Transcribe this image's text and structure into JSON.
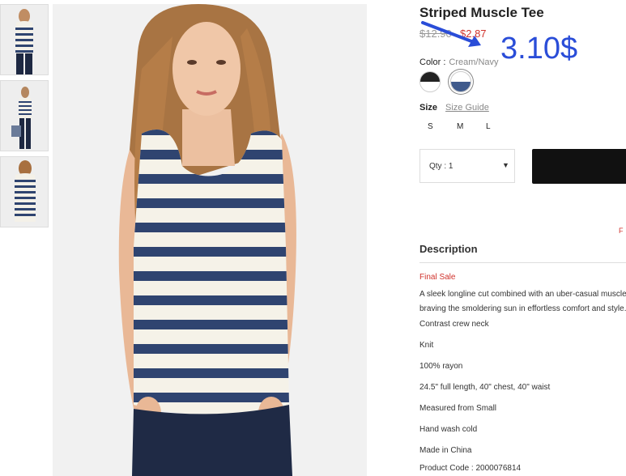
{
  "product": {
    "title": "Striped Muscle Tee",
    "old_price": "$12.90",
    "new_price": "$2.87",
    "color_label": "Color :",
    "color_value": "Cream/Navy",
    "size_label": "Size",
    "size_guide": "Size Guide",
    "sizes": [
      "S",
      "M",
      "L"
    ],
    "qty_label": "Qty : 1",
    "qty_arrow": "▼",
    "free_shipping_partial": "F"
  },
  "annotation": {
    "text": "3.10$",
    "color": "#2a4dd8"
  },
  "swatches": [
    {
      "name": "black",
      "top": "#222222",
      "bottom": "#ffffff"
    },
    {
      "name": "cream-navy",
      "top": "#ffffff",
      "bottom": "#3f5a8c"
    }
  ],
  "description": {
    "heading": "Description",
    "final_sale": "Final Sale",
    "paragraph_line1": "A sleek longline cut combined with an uber-casual muscle",
    "paragraph_line2": "braving the smoldering sun in effortless comfort and style.",
    "specs": [
      "Contrast crew neck",
      "Knit",
      "100% rayon",
      "24.5\" full length, 40\" chest, 40\" waist",
      "Measured from Small",
      "Hand wash cold",
      "Made in China",
      "Product Code : 2000076814"
    ]
  },
  "colors": {
    "sale_red": "#d0322c",
    "stripe_navy": "#2f4470",
    "button_black": "#111111"
  }
}
